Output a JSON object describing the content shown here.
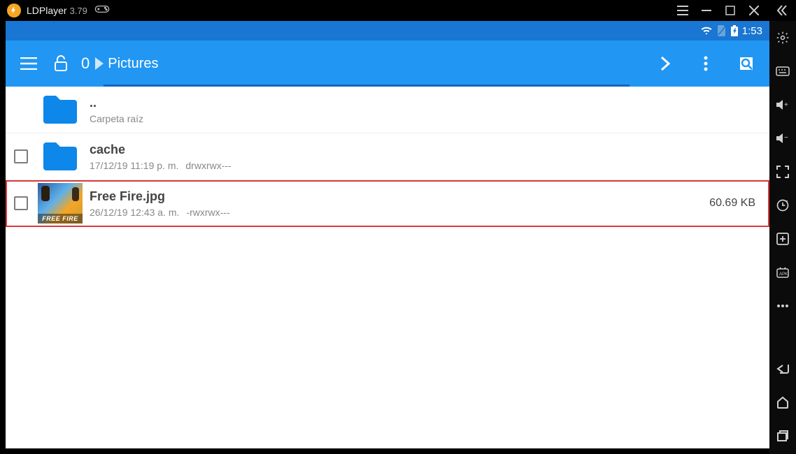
{
  "titlebar": {
    "app": "LDPlayer",
    "version": "3.79"
  },
  "statusbar": {
    "time": "1:53"
  },
  "toolbar": {
    "counter": "0",
    "breadcrumb": "Pictures"
  },
  "files": [
    {
      "name": "..",
      "sub": "Carpeta raíz"
    },
    {
      "name": "cache",
      "date": "17/12/19 11:19 p. m.",
      "perm": "drwxrwx---"
    },
    {
      "name": "Free Fire.jpg",
      "date": "26/12/19 12:43 a. m.",
      "perm": "-rwxrwx---",
      "size": "60.69 KB",
      "thumb_text": "FREE FIRE"
    }
  ]
}
